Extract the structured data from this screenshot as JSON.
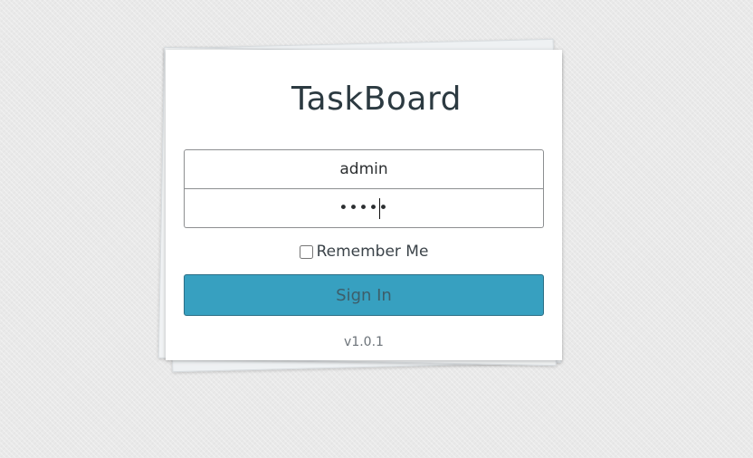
{
  "app": {
    "title": "TaskBoard",
    "version": "v1.0.1"
  },
  "login": {
    "username_value": "admin",
    "password_value": "admin",
    "remember_label": "Remember Me",
    "remember_checked": false,
    "signin_label": "Sign In"
  },
  "colors": {
    "page_background": "#e9e9e9",
    "card_background": "#ffffff",
    "title_text": "#2c3a41",
    "button_background": "#37a0c0",
    "button_border": "#2c6f86",
    "button_text": "#3d5e6a"
  }
}
